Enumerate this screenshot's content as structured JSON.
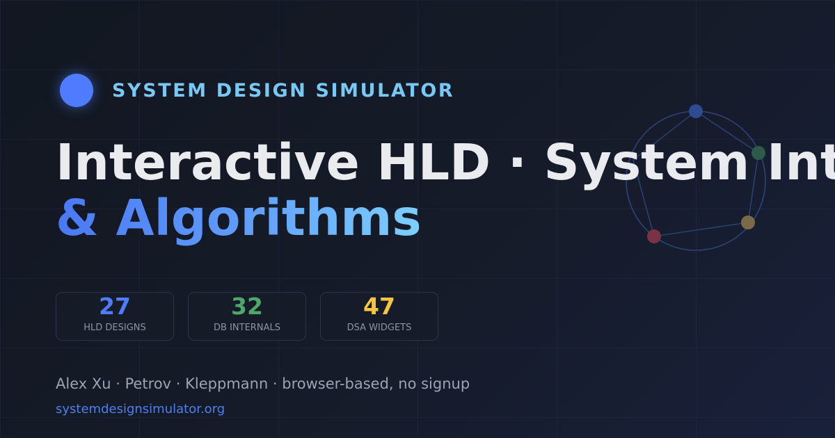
{
  "brand": {
    "name": "SYSTEM DESIGN SIMULATOR",
    "accent_color": "#4f7cff"
  },
  "headline": {
    "line1": "Interactive HLD · System Internals",
    "line2": "& Algorithms"
  },
  "stats": [
    {
      "value": "27",
      "label": "HLD DESIGNS",
      "color": "#4f7cff"
    },
    {
      "value": "32",
      "label": "DB INTERNALS",
      "color": "#4fa66b"
    },
    {
      "value": "47",
      "label": "DSA WIDGETS",
      "color": "#f5c542"
    }
  ],
  "network_nodes": [
    {
      "color": "#2f4a91"
    },
    {
      "color": "#2e5a4a"
    },
    {
      "color": "#7a6a47"
    },
    {
      "color": "#7a3344"
    }
  ],
  "tagline": "Alex Xu · Petrov · Kleppmann · browser-based, no signup",
  "site": {
    "url": "systemdesignsimulator.org"
  }
}
